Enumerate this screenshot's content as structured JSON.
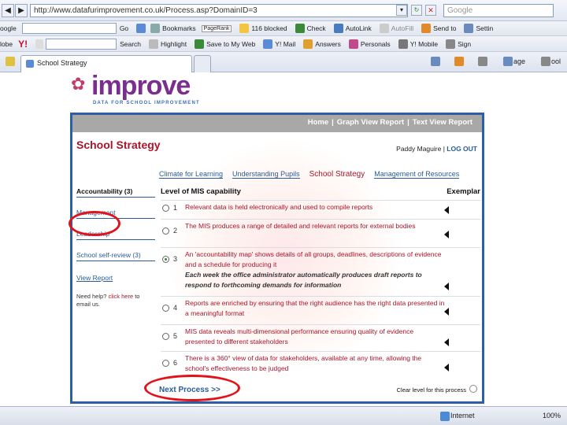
{
  "browser": {
    "address": "http://www.datafurimprovement.co.uk/Process.asp?DomainID=3",
    "search_placeholder": "Google",
    "toolbar1": {
      "search_engine": "oogle",
      "go": "Go",
      "bookmarks": "Bookmarks",
      "pagerank": "PageRank",
      "blocked": "116 blocked",
      "check": "Check",
      "autolink": "AutoLink",
      "autofill": "AutoFill",
      "send_to": "Send to",
      "settings": "Settin"
    },
    "toolbar2": {
      "globe": "lobe",
      "brand": "Y!",
      "search": "Search",
      "highlight": "Highlight",
      "save": "Save to My Web",
      "mail": "Y! Mail",
      "answers": "Answers",
      "personals": "Personals",
      "mobile": "Y! Mobile",
      "sign": "Sign"
    },
    "tab_title": "School Strategy",
    "cmd_page": "age",
    "cmd_tools": "ool",
    "status_zone": "Internet",
    "status_zoom": "100%"
  },
  "logo": {
    "word": "improve",
    "tagline": "DATA FOR SCHOOL IMPROVEMENT"
  },
  "topnav": [
    "Home",
    "Graph View Report",
    "Text View Report"
  ],
  "page": {
    "title": "School Strategy",
    "user": "Paddy Maguire",
    "logout": "LOG OUT",
    "subnav": [
      "Climate for Learning",
      "Understanding Pupils",
      "School Strategy",
      "Management of Resources"
    ],
    "side": {
      "accountability": "Accountability (3)",
      "management": "Management",
      "leadership": "Leadership",
      "school_self_review": "School self-review (3)",
      "view_report": "View Report",
      "help_prefix": "Need help? ",
      "help_link": "click here",
      "help_suffix": " to email us."
    },
    "table": {
      "heading": "Level of MIS capability",
      "exemplar": "Exemplar",
      "rows": [
        {
          "n": "1",
          "text": "Relevant data is held electronically and used to compile reports",
          "extra": ""
        },
        {
          "n": "2",
          "text": "The MIS produces a range of detailed and relevant reports for external bodies",
          "extra": ""
        },
        {
          "n": "3",
          "text": "An 'accountability map' shows details of all groups, deadlines, descriptions of evidence and a schedule for producing it",
          "extra": "Each week the office administrator automatically produces draft reports to respond to forthcoming demands for information"
        },
        {
          "n": "4",
          "text": "Reports are enriched by ensuring that the right audience has the right data presented in a meaningful format",
          "extra": ""
        },
        {
          "n": "5",
          "text": "MIS data reveals multi-dimensional performance ensuring quality of evidence presented to different stakeholders",
          "extra": ""
        },
        {
          "n": "6",
          "text": "There is a 360° view of data for stakeholders, available at any time, allowing the school's effectiveness to be judged",
          "extra": ""
        }
      ]
    },
    "next": "Next Process >>",
    "clear": "Clear level for this process"
  },
  "colors": {
    "frame": "#2d5fa7",
    "title": "#a8162b",
    "link": "#2a5c9a",
    "highlight_ring": "#e2121a"
  }
}
